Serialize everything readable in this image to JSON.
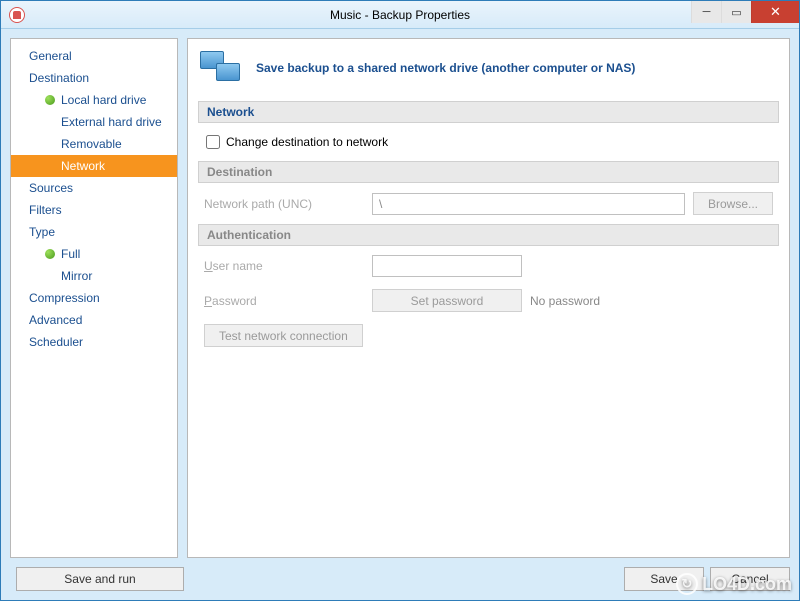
{
  "window": {
    "title": "Music - Backup Properties"
  },
  "sidebar": {
    "items": [
      {
        "label": "General",
        "level": 0
      },
      {
        "label": "Destination",
        "level": 0
      },
      {
        "label": "Local hard drive",
        "level": 1,
        "dot": true
      },
      {
        "label": "External hard drive",
        "level": 2
      },
      {
        "label": "Removable",
        "level": 2
      },
      {
        "label": "Network",
        "level": 2,
        "selected": true
      },
      {
        "label": "Sources",
        "level": 0
      },
      {
        "label": "Filters",
        "level": 0
      },
      {
        "label": "Type",
        "level": 0
      },
      {
        "label": "Full",
        "level": 1,
        "dot": true
      },
      {
        "label": "Mirror",
        "level": 2
      },
      {
        "label": "Compression",
        "level": 0
      },
      {
        "label": "Advanced",
        "level": 0
      },
      {
        "label": "Scheduler",
        "level": 0
      }
    ]
  },
  "banner": {
    "text": "Save backup to a shared network drive (another computer or NAS)"
  },
  "sections": {
    "network": "Network",
    "destination": "Destination",
    "authentication": "Authentication"
  },
  "fields": {
    "change_dest_label": "Change destination to network",
    "change_dest_checked": false,
    "network_path_label": "Network path (UNC)",
    "network_path_value": "\\",
    "browse_label": "Browse...",
    "user_label": "User name",
    "user_value": "",
    "password_label": "Password",
    "set_password_label": "Set password",
    "no_password_label": "No password",
    "test_connection_label": "Test network connection"
  },
  "footer": {
    "save_run": "Save and run",
    "save": "Save",
    "cancel": "Cancel"
  },
  "watermark": {
    "text": "LO4D.com",
    "arrow": "↻"
  }
}
